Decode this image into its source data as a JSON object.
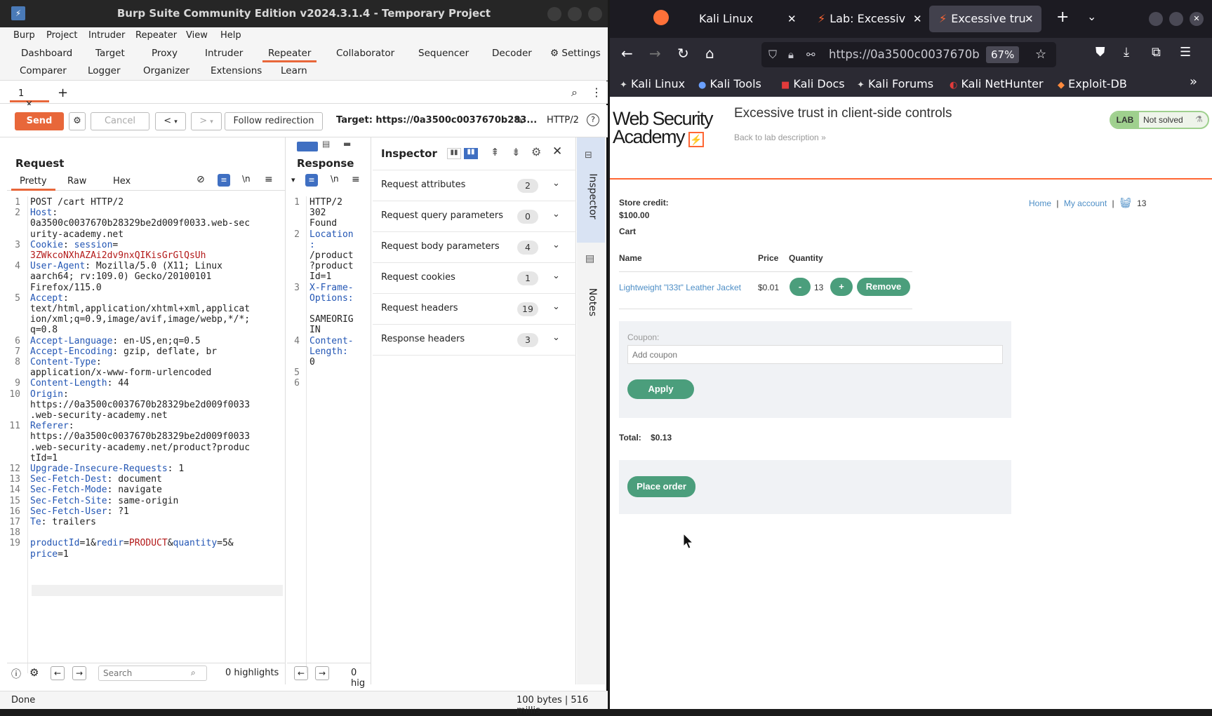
{
  "burp": {
    "window_title": "Burp Suite Community Edition v2024.3.1.4 - Temporary Project",
    "menu": [
      "Burp",
      "Project",
      "Intruder",
      "Repeater",
      "View",
      "Help"
    ],
    "tools_row1": [
      "Dashboard",
      "Target",
      "Proxy",
      "Intruder",
      "Repeater",
      "Collaborator",
      "Sequencer",
      "Decoder"
    ],
    "settings_label": "Settings",
    "tools_row2": [
      "Comparer",
      "Logger",
      "Organizer",
      "Extensions",
      "Learn"
    ],
    "active_tool": "Repeater",
    "repeater_tab": "1",
    "repeater_tab_close": "×",
    "add_tab": "+",
    "send_label": "Send",
    "cancel_label": "Cancel",
    "back_label": "<",
    "fwd_label": ">",
    "follow_redirect_label": "Follow redirection",
    "target_label": "Target: https://0a3500c0037670b283...",
    "http_version": "HTTP/2",
    "request": {
      "title": "Request",
      "tabs": [
        "Pretty",
        "Raw",
        "Hex"
      ],
      "lines": [
        {
          "n": "1",
          "parts": [
            [
              "POST /cart HTTP/2",
              "val"
            ]
          ]
        },
        {
          "n": "2",
          "parts": [
            [
              "Host",
              "key"
            ],
            [
              ":",
              "val"
            ]
          ]
        },
        {
          "n": "",
          "parts": [
            [
              "0a3500c0037670b28329be2d009f0033.web-sec",
              "val"
            ]
          ]
        },
        {
          "n": "",
          "parts": [
            [
              "urity-academy.net",
              "val"
            ]
          ]
        },
        {
          "n": "3",
          "parts": [
            [
              "Cookie",
              "key"
            ],
            [
              ": ",
              "val"
            ],
            [
              "session",
              "key"
            ],
            [
              "=",
              "val"
            ]
          ]
        },
        {
          "n": "",
          "parts": [
            [
              "3ZWkcoNXhAZAi2dv9nxQIKisGrGlQsUh",
              "red"
            ]
          ]
        },
        {
          "n": "4",
          "parts": [
            [
              "User-Agent",
              "key"
            ],
            [
              ": Mozilla/5.0 (X11; Linux",
              "val"
            ]
          ]
        },
        {
          "n": "",
          "parts": [
            [
              "aarch64; rv:109.0) Gecko/20100101",
              "val"
            ]
          ]
        },
        {
          "n": "",
          "parts": [
            [
              "Firefox/115.0",
              "val"
            ]
          ]
        },
        {
          "n": "5",
          "parts": [
            [
              "Accept",
              "key"
            ],
            [
              ":",
              "val"
            ]
          ]
        },
        {
          "n": "",
          "parts": [
            [
              "text/html,application/xhtml+xml,applicat",
              "val"
            ]
          ]
        },
        {
          "n": "",
          "parts": [
            [
              "ion/xml;q=0.9,image/avif,image/webp,*/*;",
              "val"
            ]
          ]
        },
        {
          "n": "",
          "parts": [
            [
              "q=0.8",
              "val"
            ]
          ]
        },
        {
          "n": "6",
          "parts": [
            [
              "Accept-Language",
              "key"
            ],
            [
              ": en-US,en;q=0.5",
              "val"
            ]
          ]
        },
        {
          "n": "7",
          "parts": [
            [
              "Accept-Encoding",
              "key"
            ],
            [
              ": gzip, deflate, br",
              "val"
            ]
          ]
        },
        {
          "n": "8",
          "parts": [
            [
              "Content-Type",
              "key"
            ],
            [
              ":",
              "val"
            ]
          ]
        },
        {
          "n": "",
          "parts": [
            [
              "application/x-www-form-urlencoded",
              "val"
            ]
          ]
        },
        {
          "n": "9",
          "parts": [
            [
              "Content-Length",
              "key"
            ],
            [
              ": 44",
              "val"
            ]
          ]
        },
        {
          "n": "10",
          "parts": [
            [
              "Origin",
              "key"
            ],
            [
              ":",
              "val"
            ]
          ]
        },
        {
          "n": "",
          "parts": [
            [
              "https://0a3500c0037670b28329be2d009f0033",
              "val"
            ]
          ]
        },
        {
          "n": "",
          "parts": [
            [
              ".web-security-academy.net",
              "val"
            ]
          ]
        },
        {
          "n": "11",
          "parts": [
            [
              "Referer",
              "key"
            ],
            [
              ":",
              "val"
            ]
          ]
        },
        {
          "n": "",
          "parts": [
            [
              "https://0a3500c0037670b28329be2d009f0033",
              "val"
            ]
          ]
        },
        {
          "n": "",
          "parts": [
            [
              ".web-security-academy.net/product?produc",
              "val"
            ]
          ]
        },
        {
          "n": "",
          "parts": [
            [
              "tId=1",
              "val"
            ]
          ]
        },
        {
          "n": "12",
          "parts": [
            [
              "Upgrade-Insecure-Requests",
              "key"
            ],
            [
              ": 1",
              "val"
            ]
          ]
        },
        {
          "n": "13",
          "parts": [
            [
              "Sec-Fetch-Dest",
              "key"
            ],
            [
              ": document",
              "val"
            ]
          ]
        },
        {
          "n": "14",
          "parts": [
            [
              "Sec-Fetch-Mode",
              "key"
            ],
            [
              ": navigate",
              "val"
            ]
          ]
        },
        {
          "n": "15",
          "parts": [
            [
              "Sec-Fetch-Site",
              "key"
            ],
            [
              ": same-origin",
              "val"
            ]
          ]
        },
        {
          "n": "16",
          "parts": [
            [
              "Sec-Fetch-User",
              "key"
            ],
            [
              ": ?1",
              "val"
            ]
          ]
        },
        {
          "n": "17",
          "parts": [
            [
              "Te",
              "key"
            ],
            [
              ": trailers",
              "val"
            ]
          ]
        },
        {
          "n": "18",
          "parts": [
            [
              "",
              "val"
            ]
          ]
        },
        {
          "n": "19",
          "parts": [
            [
              "productId",
              "key"
            ],
            [
              "=1&",
              "val"
            ],
            [
              "redir",
              "key"
            ],
            [
              "=",
              "val"
            ],
            [
              "PRODUCT",
              "red"
            ],
            [
              "&",
              "val"
            ],
            [
              "quantity",
              "key"
            ],
            [
              "=5&",
              "val"
            ]
          ]
        },
        {
          "n": "",
          "parts": [
            [
              "price",
              "key"
            ],
            [
              "=1",
              "val"
            ]
          ]
        }
      ],
      "search_placeholder": "Search",
      "highlights": "0 highlights"
    },
    "response": {
      "title": "Response",
      "lines": [
        {
          "n": "1",
          "parts": [
            [
              "HTTP/2",
              "val"
            ]
          ]
        },
        {
          "n": "",
          "parts": [
            [
              "302",
              "val"
            ]
          ]
        },
        {
          "n": "",
          "parts": [
            [
              "Found",
              "val"
            ]
          ]
        },
        {
          "n": "2",
          "parts": [
            [
              "Location",
              "key"
            ]
          ]
        },
        {
          "n": "",
          "parts": [
            [
              ":",
              "key"
            ]
          ]
        },
        {
          "n": "",
          "parts": [
            [
              "/product",
              "val"
            ]
          ]
        },
        {
          "n": "",
          "parts": [
            [
              "?product",
              "val"
            ]
          ]
        },
        {
          "n": "",
          "parts": [
            [
              "Id=1",
              "val"
            ]
          ]
        },
        {
          "n": "3",
          "parts": [
            [
              "X-Frame-",
              "key"
            ]
          ]
        },
        {
          "n": "",
          "parts": [
            [
              "Options:",
              "key"
            ]
          ]
        },
        {
          "n": "",
          "parts": [
            [
              "",
              "val"
            ]
          ]
        },
        {
          "n": "",
          "parts": [
            [
              "SAMEORIG",
              "val"
            ]
          ]
        },
        {
          "n": "",
          "parts": [
            [
              "IN",
              "val"
            ]
          ]
        },
        {
          "n": "4",
          "parts": [
            [
              "Content-",
              "key"
            ]
          ]
        },
        {
          "n": "",
          "parts": [
            [
              "Length:",
              "key"
            ]
          ]
        },
        {
          "n": "",
          "parts": [
            [
              "0",
              "val"
            ]
          ]
        },
        {
          "n": "5",
          "parts": [
            [
              "",
              "val"
            ]
          ]
        },
        {
          "n": "6",
          "parts": [
            [
              "",
              "val"
            ]
          ]
        }
      ],
      "highlights": "0 hig"
    },
    "inspector": {
      "title": "Inspector",
      "rows": [
        {
          "label": "Request attributes",
          "count": "2"
        },
        {
          "label": "Request query parameters",
          "count": "0"
        },
        {
          "label": "Request body parameters",
          "count": "4"
        },
        {
          "label": "Request cookies",
          "count": "1"
        },
        {
          "label": "Request headers",
          "count": "19"
        },
        {
          "label": "Response headers",
          "count": "3"
        }
      ]
    },
    "side_tabs": {
      "inspector": "Inspector",
      "notes": "Notes"
    },
    "status_left": "Done",
    "status_right": "100 bytes | 516 millis"
  },
  "firefox": {
    "tabs": [
      {
        "label": "Kali Linux"
      },
      {
        "label": "Lab: Excessiv"
      },
      {
        "label": "Excessive tru"
      }
    ],
    "url": "https://0a3500c0037670b",
    "zoom": "67%",
    "bookmarks": [
      "Kali Linux",
      "Kali Tools",
      "Kali Docs",
      "Kali Forums",
      "Kali NetHunter",
      "Exploit-DB"
    ],
    "page": {
      "logo_line1": "Web Security",
      "logo_line2": "Academy",
      "lab_title": "Excessive trust in client-side controls",
      "back_link": "Back to lab description",
      "lab_badge": "LAB",
      "lab_status": "Not solved",
      "store_credit_label": "Store credit:",
      "store_credit_value": "$100.00",
      "cart_label": "Cart",
      "nav_home": "Home",
      "nav_sep": "|",
      "nav_account": "My account",
      "cart_count": "13",
      "columns": [
        "Name",
        "Price",
        "Quantity"
      ],
      "item": {
        "name": "Lightweight \"l33t\" Leather Jacket",
        "price": "$0.01",
        "quantity": "13",
        "minus": "-",
        "plus": "+",
        "remove": "Remove"
      },
      "coupon_label": "Coupon:",
      "coupon_placeholder": "Add coupon",
      "apply_label": "Apply",
      "total_label": "Total:",
      "total_value": "$0.13",
      "place_order_label": "Place order"
    }
  }
}
